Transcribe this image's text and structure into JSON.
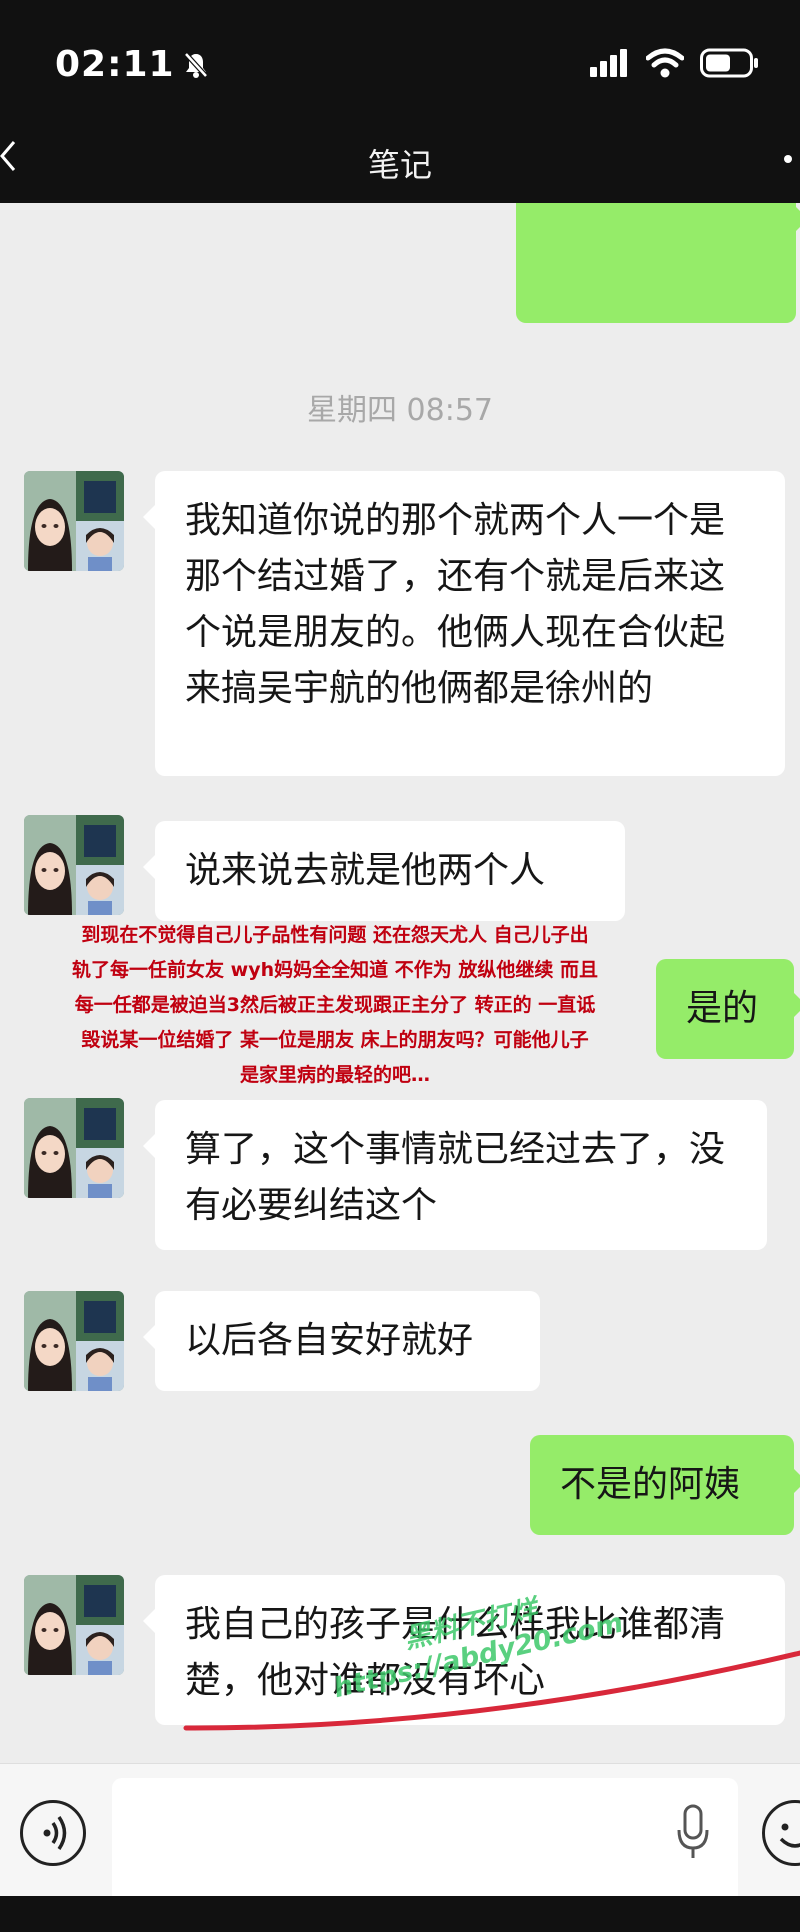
{
  "status_bar": {
    "time": "02:11"
  },
  "nav": {
    "title": "笔记"
  },
  "chat": {
    "timestamp": "星期四 08:57",
    "messages": [
      {
        "text": "我知道你说的那个就两个人一个是那个结过婚了，还有个就是后来这个说是朋友的。他俩人现在合伙起来搞吴宇航的他俩都是徐州的"
      },
      {
        "text": "说来说去就是他两个人"
      },
      {
        "text": "是的"
      },
      {
        "text": "算了，这个事情就已经过去了，没有必要纠结这个"
      },
      {
        "text": "以后各自安好就好"
      },
      {
        "text": "不是的阿姨"
      },
      {
        "text": "我自己的孩子是什么样我比谁都清楚，他对谁都没有坏心"
      }
    ]
  },
  "annotation": {
    "lines": [
      "到现在不觉得自己儿子品性有问题 还在怨天尤人 自己儿子出",
      "轨了每一任前女友 wyh妈妈全全知道 不作为 放纵他继续 而且",
      "每一任都是被迫当3然后被正主发现跟正主分了 转正的 一直诋",
      "毁说某一位结婚了 某一位是朋友 床上的朋友吗？可能他儿子",
      "是家里病的最轻的吧…"
    ],
    "color": "#c00010"
  },
  "watermark": {
    "line1": "黑料不打烊",
    "line2": "https://abdy20.com"
  },
  "colors": {
    "outgoing_bubble": "#95ec69",
    "incoming_bubble": "#ffffff",
    "chat_bg": "#ededed",
    "underline": "#d8283a"
  },
  "icons": {
    "back": "chevron-left-icon",
    "more": "more-dot-icon",
    "voice": "voice-icon",
    "mic": "microphone-icon",
    "emoji": "emoji-icon",
    "mute": "bell-slash-icon",
    "signal": "signal-icon",
    "wifi": "wifi-icon",
    "battery": "battery-icon"
  }
}
